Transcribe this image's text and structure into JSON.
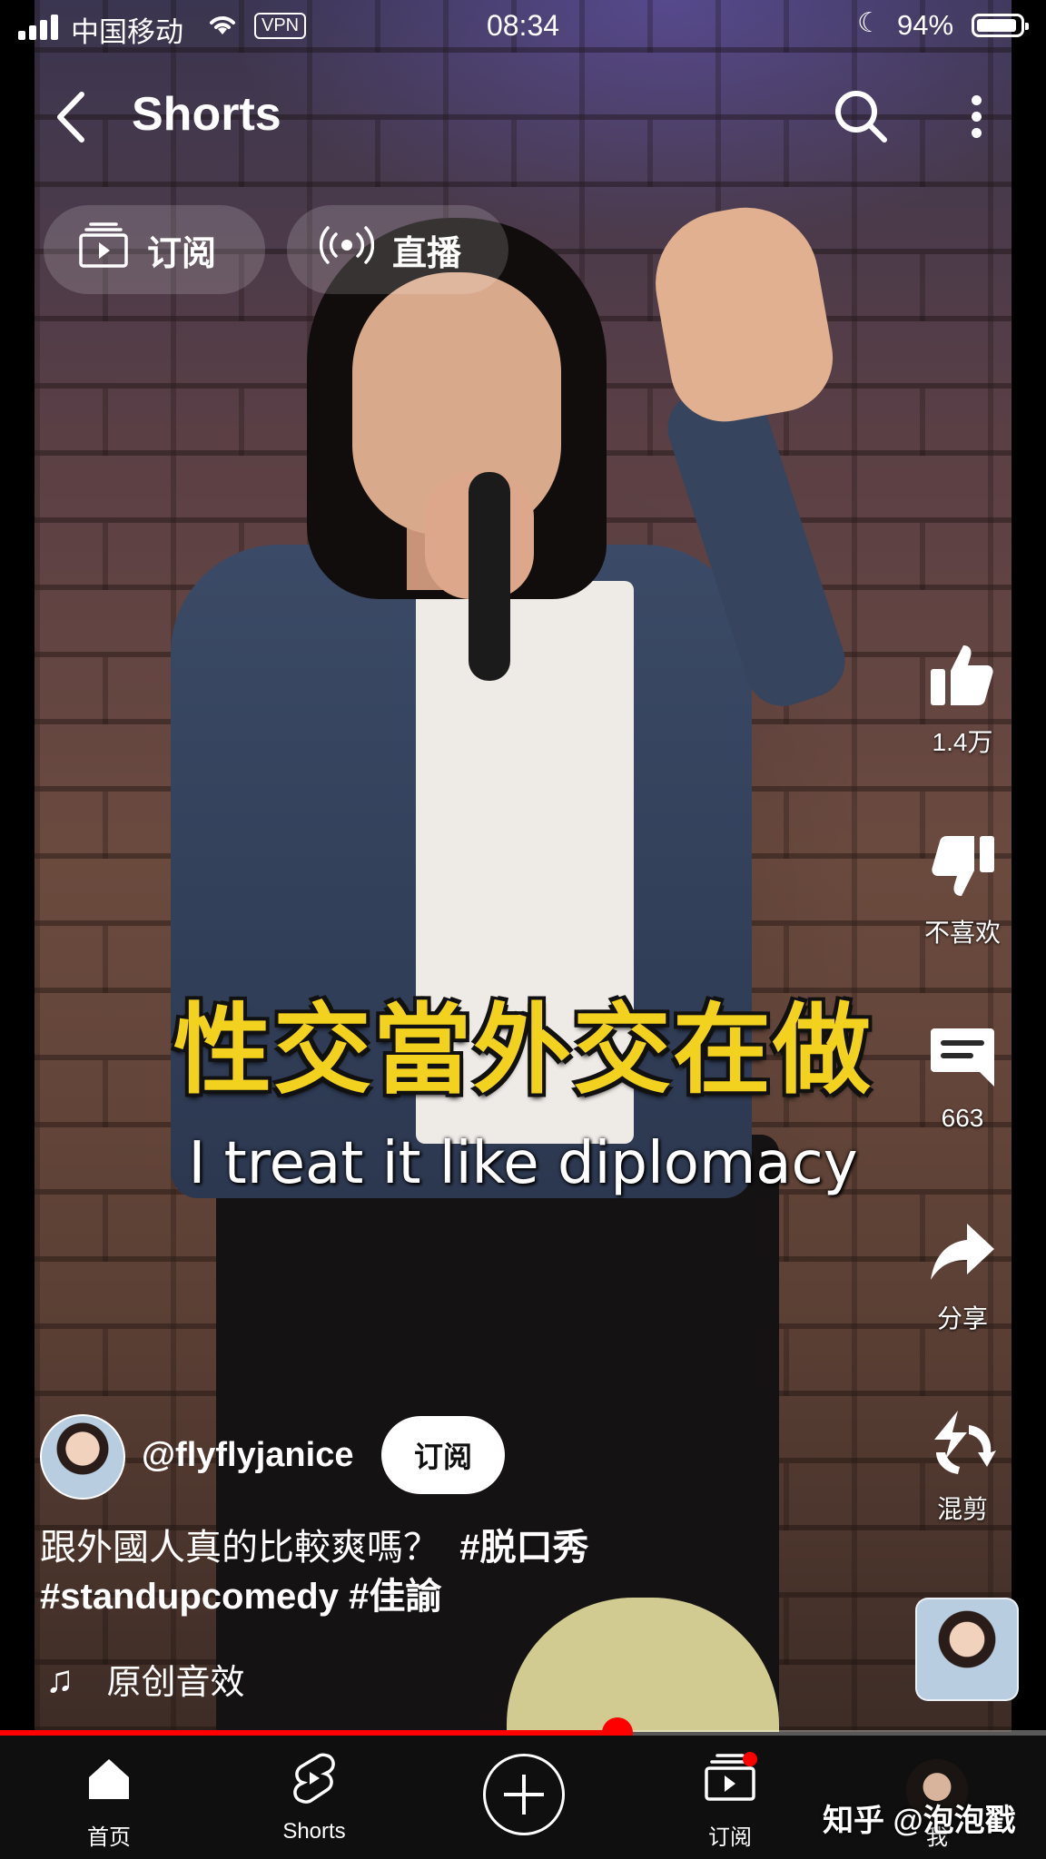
{
  "status_bar": {
    "carrier": "中国移动",
    "vpn": "VPN",
    "time": "08:34",
    "battery": "94%",
    "battery_level": 0.94
  },
  "top_bar": {
    "title": "Shorts"
  },
  "chips": {
    "subscriptions": "订阅",
    "live": "直播"
  },
  "video": {
    "caption_cn": "性交當外交在做",
    "caption_en": "I treat it like diplomacy"
  },
  "actions": {
    "like_count": "1.4万",
    "dislike_label": "不喜欢",
    "comment_count": "663",
    "share_label": "分享",
    "remix_label": "混剪"
  },
  "channel": {
    "handle": "@flyflyjanice",
    "subscribe_label": "订阅"
  },
  "description": {
    "text": "跟外國人真的比較爽嗎？",
    "hashtag1": "#脱口秀",
    "hashtag2": "#standupcomedy",
    "hashtag3": "#佳諭"
  },
  "sound": {
    "label": "原创音效"
  },
  "playback": {
    "progress": 0.59
  },
  "bottom_nav": {
    "home": "首页",
    "shorts": "Shorts",
    "subscriptions": "订阅",
    "me": "我"
  },
  "watermark": "知乎 @泡泡戳",
  "colors": {
    "accent": "#ff0000",
    "caption_yellow": "#f3d21f",
    "nav_bg": "#0f0f0f"
  }
}
